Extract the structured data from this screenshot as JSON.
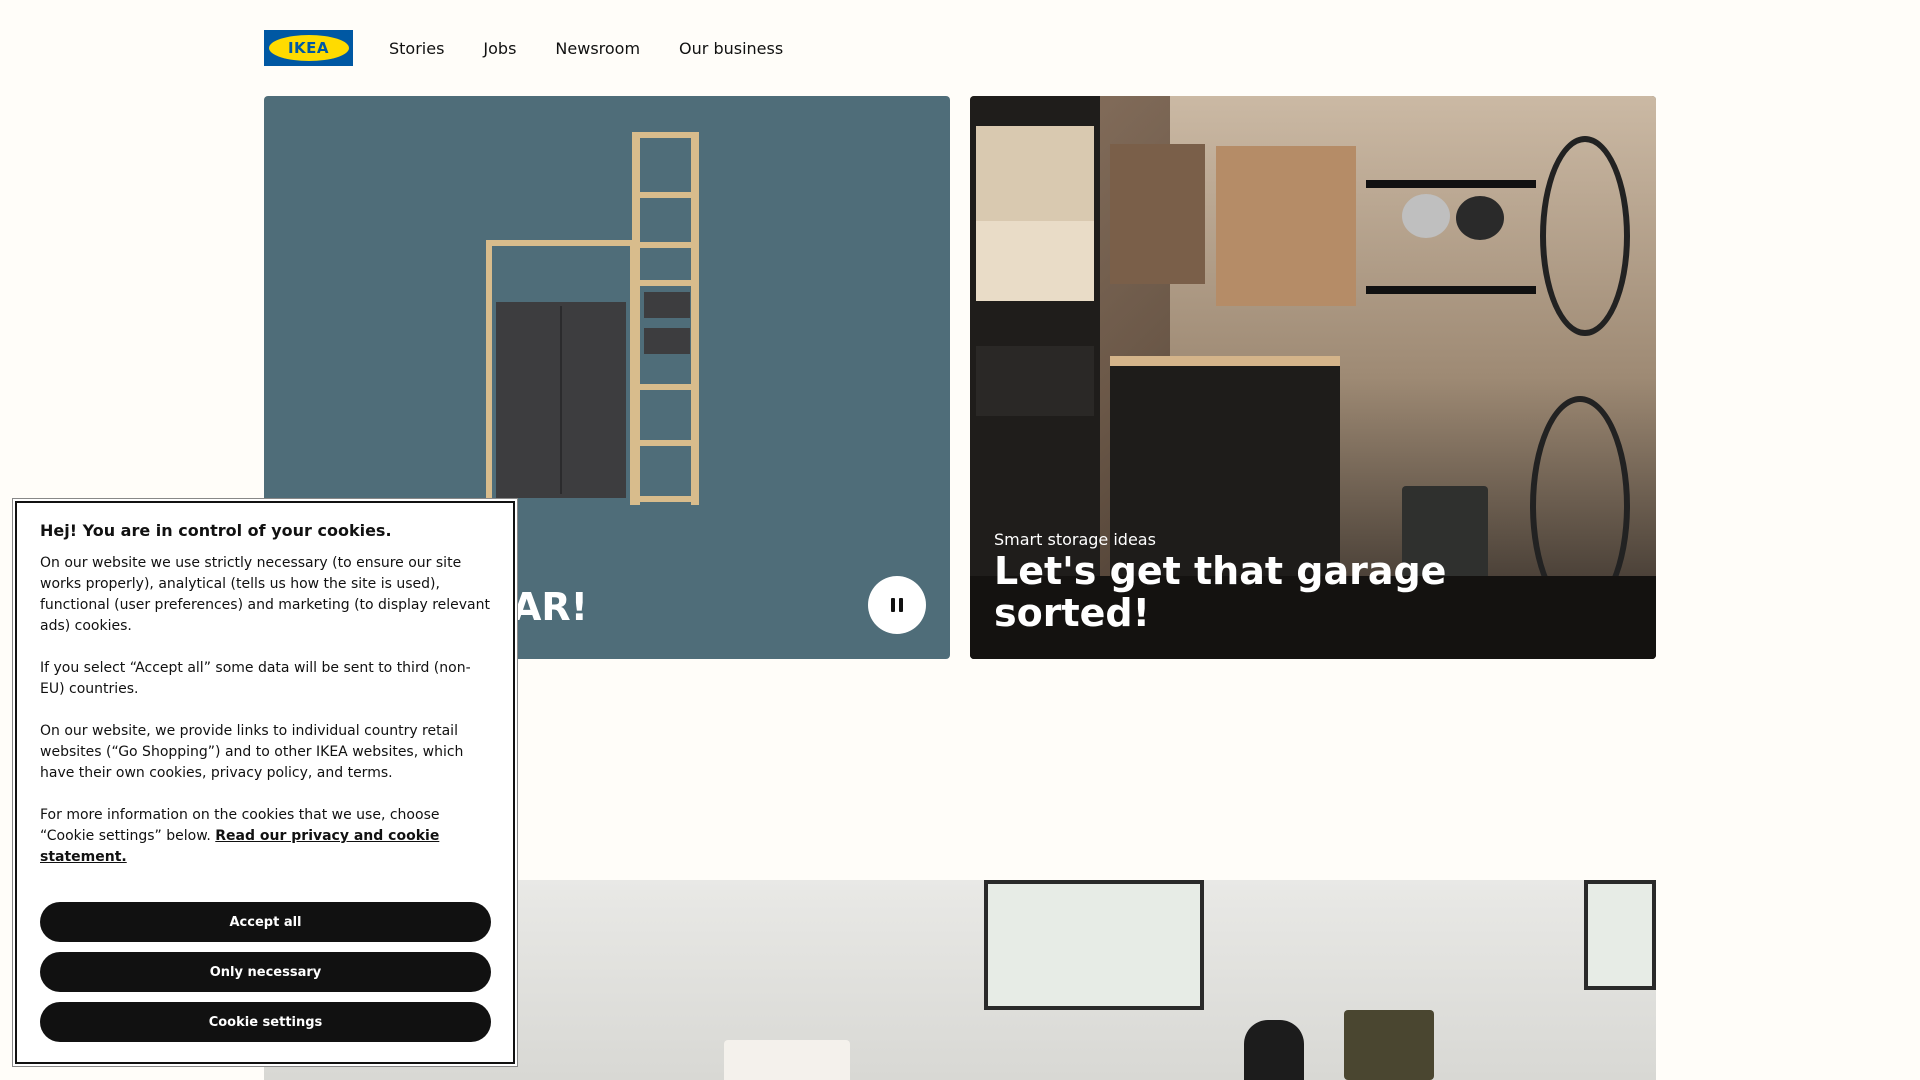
{
  "header": {
    "logo_text": "IKEA",
    "nav": [
      {
        "label": "Stories"
      },
      {
        "label": "Jobs"
      },
      {
        "label": "Newsroom"
      },
      {
        "label": "Our business"
      }
    ]
  },
  "hero": {
    "left_title_visible": "AR!",
    "pause_icon": "pause-icon",
    "right_eyebrow": "Smart storage ideas",
    "right_title": "Let's get that garage sorted!"
  },
  "cookie": {
    "title": "Hej! You are in control of your cookies.",
    "p1": "On our website we use strictly necessary (to ensure our site works properly), analytical (tells us how the site is used), functional (user preferences) and marketing (to display relevant ads) cookies.",
    "p2": "If you select “Accept all” some data will be sent to third (non-EU) countries.",
    "p3": "On our website, we provide links to individual country retail websites (“Go Shopping”) and to other IKEA websites, which have their own cookies, privacy policy, and terms.",
    "p4_prefix": "For more information on the cookies that we use, choose “Cookie settings” below.",
    "p4_link": "Read our privacy and cookie statement.",
    "accept_all": "Accept all",
    "only_necessary": "Only necessary",
    "cookie_settings": "Cookie settings"
  },
  "colors": {
    "brand_blue": "#0058a3",
    "brand_yellow": "#ffdb00",
    "left_tile": "#4f6d79",
    "button": "#111111"
  }
}
